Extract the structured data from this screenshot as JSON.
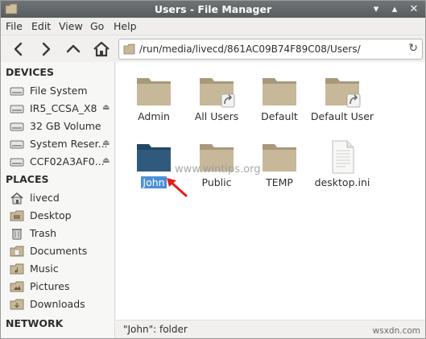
{
  "window": {
    "title": "Users - File Manager"
  },
  "menubar": {
    "items": [
      "File",
      "Edit",
      "View",
      "Go",
      "Help"
    ]
  },
  "toolbar": {
    "path": "/run/media/livecd/861AC09B74F89C08/Users/"
  },
  "sidebar": {
    "devices_heading": "DEVICES",
    "devices": [
      {
        "label": "File System",
        "icon": "drive-icon",
        "eject": false
      },
      {
        "label": "IR5_CCSA_X8",
        "icon": "drive-icon",
        "eject": true
      },
      {
        "label": "32 GB Volume",
        "icon": "drive-icon",
        "eject": false
      },
      {
        "label": "System Reser...",
        "icon": "drive-icon",
        "eject": true
      },
      {
        "label": "CCF02A3AF0...",
        "icon": "drive-icon",
        "eject": true
      }
    ],
    "places_heading": "PLACES",
    "places": [
      {
        "label": "livecd",
        "icon": "home-icon"
      },
      {
        "label": "Desktop",
        "icon": "folder-icon"
      },
      {
        "label": "Trash",
        "icon": "trash-icon"
      },
      {
        "label": "Documents",
        "icon": "folder-icon"
      },
      {
        "label": "Music",
        "icon": "folder-icon"
      },
      {
        "label": "Pictures",
        "icon": "folder-icon"
      },
      {
        "label": "Downloads",
        "icon": "folder-icon"
      }
    ],
    "network_heading": "NETWORK"
  },
  "files": [
    {
      "name": "Admin",
      "type": "folder",
      "link": false,
      "selected": false
    },
    {
      "name": "All Users",
      "type": "folder",
      "link": true,
      "selected": false
    },
    {
      "name": "Default",
      "type": "folder",
      "link": false,
      "selected": false
    },
    {
      "name": "Default User",
      "type": "folder",
      "link": true,
      "selected": false
    },
    {
      "name": "John",
      "type": "folder",
      "link": false,
      "selected": true
    },
    {
      "name": "Public",
      "type": "folder",
      "link": false,
      "selected": false
    },
    {
      "name": "TEMP",
      "type": "folder",
      "link": false,
      "selected": false
    },
    {
      "name": "desktop.ini",
      "type": "file",
      "link": false,
      "selected": false
    }
  ],
  "watermark": "www.wintips.org",
  "statusbar": {
    "text": "\"John\": folder"
  },
  "corner_mark": "wsxdn.com",
  "colors": {
    "selection": "#4a90d9",
    "folder": "#c8b89a",
    "folder_selected": "#2f5a7e",
    "arrow": "#e0211b"
  }
}
